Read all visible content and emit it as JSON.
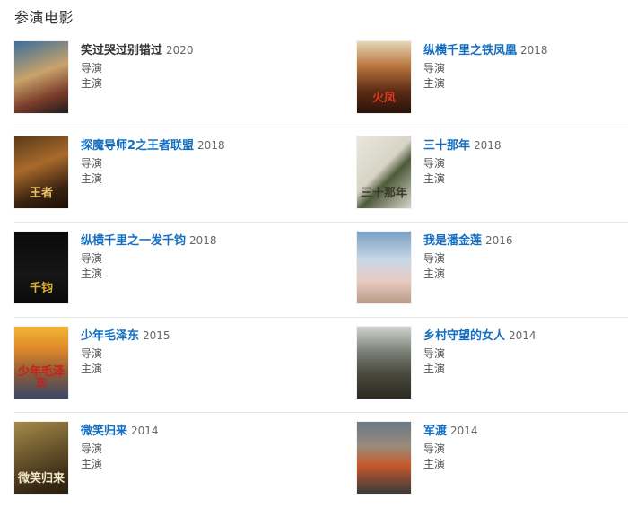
{
  "section": {
    "title": "参演电影"
  },
  "movies": [
    {
      "title": "笑过哭过别错过",
      "year": "2020",
      "roles": [
        "导演",
        "主演"
      ],
      "poster": {
        "bg": "linear-gradient(160deg,#3b6e9c 0%,#c9a36a 45%,#7a3b2a 75%,#1e1e1e 100%)"
      }
    },
    {
      "title": "纵横千里之铁凤凰",
      "year": "2018",
      "roles": [
        "导演",
        "主演"
      ],
      "poster": {
        "bg": "linear-gradient(180deg,#e6d7b8 0%,#b8743c 35%,#5a2a14 70%,#2a140a 100%)",
        "glyph": "火凤",
        "glyph_color": "#d83a1e"
      }
    },
    {
      "title": "探魔导师2之王者联盟",
      "year": "2018",
      "roles": [
        "导演",
        "主演"
      ],
      "poster": {
        "bg": "linear-gradient(160deg,#5a3a1a 0%,#a86a2a 40%,#3a2210 75%,#1a0e06 100%)",
        "glyph": "王者",
        "glyph_color": "#e6c06a"
      }
    },
    {
      "title": "三十那年",
      "year": "2018",
      "roles": [
        "导演",
        "主演"
      ],
      "poster": {
        "bg": "linear-gradient(135deg,#e9e7dd 0%,#d7d4c6 45%,#4e5a3a 60%,#d8d6cb 100%)",
        "glyph": "三十那年",
        "glyph_color": "#3a3a2a"
      }
    },
    {
      "title": "纵横千里之一发千钧",
      "year": "2018",
      "roles": [
        "导演",
        "主演"
      ],
      "poster": {
        "bg": "linear-gradient(180deg,#0a0a0a 0%,#161616 60%,#0a0a0a 100%)",
        "glyph": "千钧",
        "glyph_color": "#e0b030"
      }
    },
    {
      "title": "我是潘金莲",
      "year": "2016",
      "roles": [
        "导演",
        "主演"
      ],
      "poster": {
        "bg": "linear-gradient(180deg,#7aa0c4 0%,#c9d8e6 40%,#e9c9c0 70%,#b79a86 100%)"
      }
    },
    {
      "title": "少年毛泽东",
      "year": "2015",
      "roles": [
        "导演",
        "主演"
      ],
      "poster": {
        "bg": "linear-gradient(180deg,#f2b533 0%,#e08a2a 30%,#8a5a3a 65%,#3a4a6a 100%)",
        "glyph": "少年毛泽东",
        "glyph_color": "#c8201a"
      }
    },
    {
      "title": "乡村守望的女人",
      "year": "2014",
      "roles": [
        "导演",
        "主演"
      ],
      "poster": {
        "bg": "linear-gradient(180deg,#cfd3cf 0%,#7a7f76 35%,#4a4a3e 65%,#2c2a22 100%)"
      }
    },
    {
      "title": "微笑归来",
      "year": "2014",
      "roles": [
        "导演",
        "主演"
      ],
      "poster": {
        "bg": "linear-gradient(160deg,#a88a4a 0%,#6e5a2e 40%,#3a2a16 80%,#2a1e10 100%)",
        "glyph": "微笑归来",
        "glyph_color": "#f0e6c8"
      }
    },
    {
      "title": "军渡",
      "year": "2014",
      "roles": [
        "导演",
        "主演"
      ],
      "poster": {
        "bg": "linear-gradient(180deg,#6a7a86 0%,#9a8a7a 35%,#c85a2a 60%,#3a3a3a 100%)"
      }
    }
  ]
}
